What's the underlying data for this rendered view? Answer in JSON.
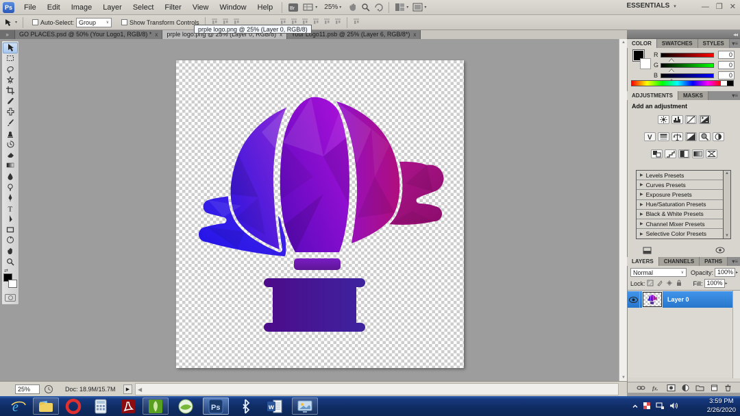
{
  "app": {
    "title": "Adobe Photoshop",
    "logo": "Ps"
  },
  "menubar": {
    "menus": [
      "File",
      "Edit",
      "Image",
      "Layer",
      "Select",
      "Filter",
      "View",
      "Window",
      "Help"
    ],
    "zoom_level": "25%",
    "workspace": "ESSENTIALS",
    "icons": [
      "bridge-icon",
      "extras-icon",
      "zoom-dropdown",
      "hand-icon",
      "magnifier-icon",
      "rotate-view-icon",
      "arrange-documents-icon",
      "screen-mode-icon"
    ],
    "window_buttons": [
      "minimize",
      "restore",
      "close"
    ]
  },
  "optionsbar": {
    "tool": "move-tool",
    "auto_select_label": "Auto-Select:",
    "auto_select_value": "Group",
    "show_transform_label": "Show Transform Controls",
    "align_icons": [
      "align-top-icon",
      "align-vcenter-icon",
      "align-bottom-icon"
    ],
    "distribute_icons": [
      "dist-1",
      "dist-2",
      "dist-3",
      "dist-4",
      "dist-5",
      "dist-6"
    ],
    "auto_align_icon": "auto-align-icon"
  },
  "tooltip": {
    "text": "prple logo.png @ 25% (Layer 0, RGB/8)"
  },
  "tabs": [
    {
      "label": "GO PLACES.psd @ 50% (Your Logo1, RGB/8) *",
      "close": "x",
      "active": false
    },
    {
      "label": "prple logo.png @ 25% (Layer 0, RGB/8)",
      "close": "x",
      "active": true
    },
    {
      "label": "Your Logo11.psb @ 25% (Layer 6, RGB/8*)",
      "close": "x",
      "active": false
    }
  ],
  "tools": [
    "move-tool",
    "marquee-tool",
    "lasso-tool",
    "quick-selection-tool",
    "crop-tool",
    "eyedropper-tool",
    "healing-brush-tool",
    "brush-tool",
    "clone-stamp-tool",
    "history-brush-tool",
    "eraser-tool",
    "gradient-tool",
    "blur-tool",
    "dodge-tool",
    "pen-tool",
    "type-tool",
    "path-selection-tool",
    "rectangle-tool",
    "rotate-view-tool",
    "hand-tool",
    "zoom-tool"
  ],
  "color_panel": {
    "tabs": [
      "COLOR",
      "SWATCHES",
      "STYLES"
    ],
    "channels": [
      {
        "label": "R",
        "value": "0"
      },
      {
        "label": "G",
        "value": "0"
      },
      {
        "label": "B",
        "value": "0"
      }
    ]
  },
  "adjustments_panel": {
    "tabs": [
      "ADJUSTMENTS",
      "MASKS"
    ],
    "heading": "Add an adjustment",
    "icon_rows": [
      [
        "brightness-contrast-icon",
        "levels-icon",
        "curves-icon",
        "exposure-icon"
      ],
      [
        "vibrance-icon",
        "hue-saturation-icon",
        "color-balance-icon",
        "black-white-icon",
        "photo-filter-icon",
        "channel-mixer-icon"
      ],
      [
        "invert-icon",
        "posterize-icon",
        "threshold-icon",
        "gradient-map-icon",
        "selective-color-icon"
      ]
    ],
    "presets": [
      "Levels Presets",
      "Curves Presets",
      "Exposure Presets",
      "Hue/Saturation Presets",
      "Black & White Presets",
      "Channel Mixer Presets",
      "Selective Color Presets"
    ]
  },
  "layers_panel": {
    "tabs": [
      "LAYERS",
      "CHANNELS",
      "PATHS"
    ],
    "blend_mode": "Normal",
    "opacity_label": "Opacity:",
    "opacity_value": "100%",
    "lock_label": "Lock:",
    "fill_label": "Fill:",
    "fill_value": "100%",
    "layer_name": "Layer 0",
    "footer_icons": [
      "link-icon",
      "fx-icon",
      "mask-icon",
      "adjustment-icon",
      "group-icon",
      "new-layer-icon",
      "trash-icon"
    ]
  },
  "statusbar": {
    "zoom": "25%",
    "doc_info": "Doc: 18.9M/15.7M"
  },
  "taskbar": {
    "icons": [
      "ie-icon",
      "explorer-icon",
      "opera-icon",
      "calculator-icon",
      "acrobat-icon",
      "coreldraw-icon",
      "corel-orb-icon",
      "photoshop-icon",
      "bluetooth-icon",
      "word-icon",
      "presentation-icon"
    ],
    "tray_icons": [
      "hidden-icons-arrow",
      "flag-icon",
      "network-icon",
      "speaker-icon"
    ],
    "time": "3:59 PM",
    "date": "2/26/2020"
  },
  "logo_colors": {
    "left_section": [
      "#2a12dd",
      "#8a28d8"
    ],
    "center_gore": [
      "#5c0abf",
      "#a910d8"
    ],
    "right_section": [
      "#9110cc",
      "#b00e7c"
    ],
    "ribbon_left": [
      "#2012e8",
      "#4a28e8"
    ],
    "ribbon_right": [
      "#b01590",
      "#8c0c6a"
    ],
    "collar": [
      "#7a1cc4",
      "#5d1695"
    ],
    "basket": [
      "#4c0b8a",
      "#3e239f"
    ]
  }
}
